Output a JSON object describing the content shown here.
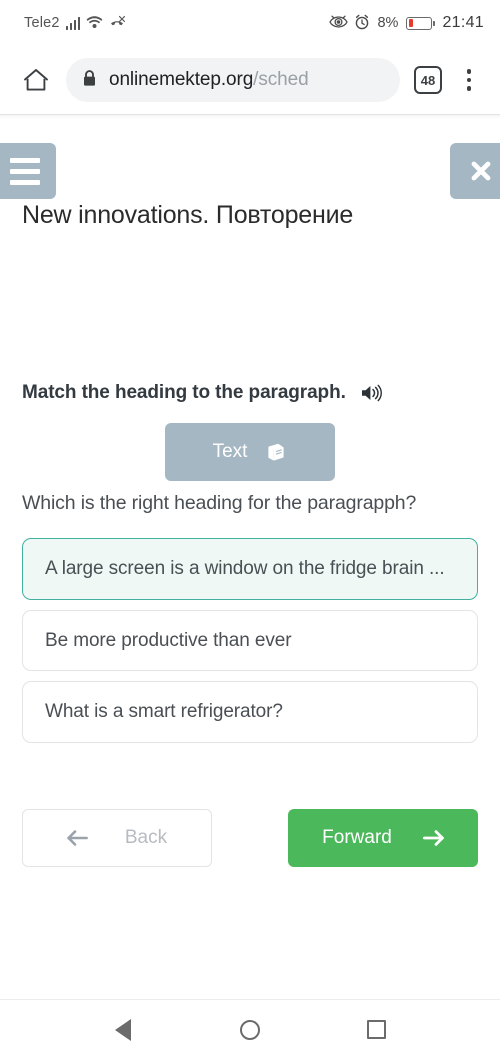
{
  "status_bar": {
    "carrier": "Tele2",
    "battery_percent": "8%",
    "clock": "21:41",
    "icons": [
      "signal-bars-icon",
      "wifi-icon",
      "missed-call-icon",
      "eye-comfort-icon",
      "alarm-icon",
      "battery-icon"
    ]
  },
  "browser": {
    "home_icon": "home-icon",
    "lock_icon": "lock-icon",
    "url_host": "onlinemektep.org",
    "url_path": "/sched",
    "tab_count": "48",
    "menu_icon": "kebab-menu-icon"
  },
  "page": {
    "menu_button_icon": "hamburger-icon",
    "close_button_icon": "close-icon",
    "lesson_title": "New innovations. Повторение",
    "task_title": "Match the heading to the paragraph.",
    "audio_icon": "speaker-icon",
    "text_button": {
      "label": "Text",
      "icon": "book-icon"
    },
    "question": "Which is the right heading for the paragrapph?",
    "options": [
      {
        "text": "A large screen is a window on the fridge brain ...",
        "selected": true
      },
      {
        "text": "Be more productive than ever",
        "selected": false
      },
      {
        "text": "What is a smart refrigerator?",
        "selected": false
      }
    ],
    "back_button": {
      "label": "Back",
      "icon": "arrow-left-icon"
    },
    "forward_button": {
      "label": "Forward",
      "icon": "arrow-right-icon"
    }
  },
  "android_nav": {
    "back_icon": "nav-back-triangle-icon",
    "home_icon": "nav-home-circle-icon",
    "recents_icon": "nav-recents-square-icon"
  },
  "colors": {
    "accent_green": "#4cb85c",
    "selected_border": "#44b09e",
    "selected_bg": "#eff8f5",
    "slate_button": "#a4b7c3",
    "battery_red": "#e8392f"
  }
}
